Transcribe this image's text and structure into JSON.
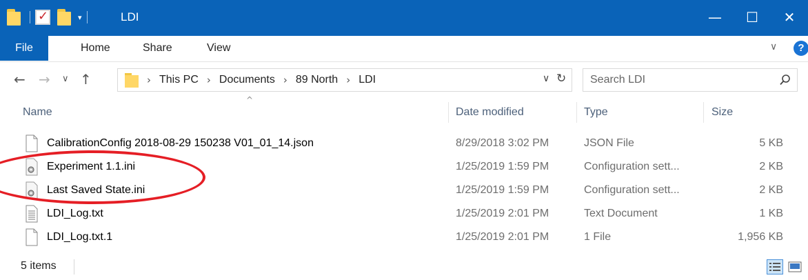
{
  "window": {
    "title": "LDI",
    "minimize_glyph": "—",
    "maximize_glyph": "☐",
    "close_glyph": "✕"
  },
  "quick_access": {
    "icons": [
      "folder-icon",
      "properties-check-icon",
      "new-folder-icon",
      "customize-dropdown-icon"
    ]
  },
  "ribbon": {
    "file_label": "File",
    "tabs": [
      "Home",
      "Share",
      "View"
    ],
    "collapse_glyph": "∨",
    "help_glyph": "?"
  },
  "nav": {
    "back_glyph": "←",
    "forward_glyph": "→",
    "recent_glyph": "∨",
    "up_glyph": "↑"
  },
  "address": {
    "crumbs": [
      "This PC",
      "Documents",
      "89 North",
      "LDI"
    ],
    "dropdown_glyph": "∨",
    "refresh_glyph": "↻"
  },
  "search": {
    "placeholder": "Search LDI"
  },
  "columns": {
    "name": "Name",
    "date_modified": "Date modified",
    "type": "Type",
    "size": "Size",
    "sort_glyph": "^"
  },
  "files": [
    {
      "name": "CalibrationConfig 2018-08-29 150238 V01_01_14.json",
      "date": "8/29/2018 3:02 PM",
      "type": "JSON File",
      "size": "5 KB",
      "icon": "blank-file-icon"
    },
    {
      "name": "Experiment 1.1.ini",
      "date": "1/25/2019 1:59 PM",
      "type": "Configuration sett...",
      "size": "2 KB",
      "icon": "config-settings-icon"
    },
    {
      "name": "Last Saved State.ini",
      "date": "1/25/2019 1:59 PM",
      "type": "Configuration sett...",
      "size": "2 KB",
      "icon": "config-settings-icon"
    },
    {
      "name": "LDI_Log.txt",
      "date": "1/25/2019 2:01 PM",
      "type": "Text Document",
      "size": "1 KB",
      "icon": "text-document-icon"
    },
    {
      "name": "LDI_Log.txt.1",
      "date": "1/25/2019 2:01 PM",
      "type": "1 File",
      "size": "1,956 KB",
      "icon": "blank-file-icon"
    }
  ],
  "status": {
    "item_count": "5 items"
  },
  "colors": {
    "titlebar": "#0a63b8",
    "annotation_circle": "#e51e25",
    "column_header_text": "#4c607a"
  }
}
